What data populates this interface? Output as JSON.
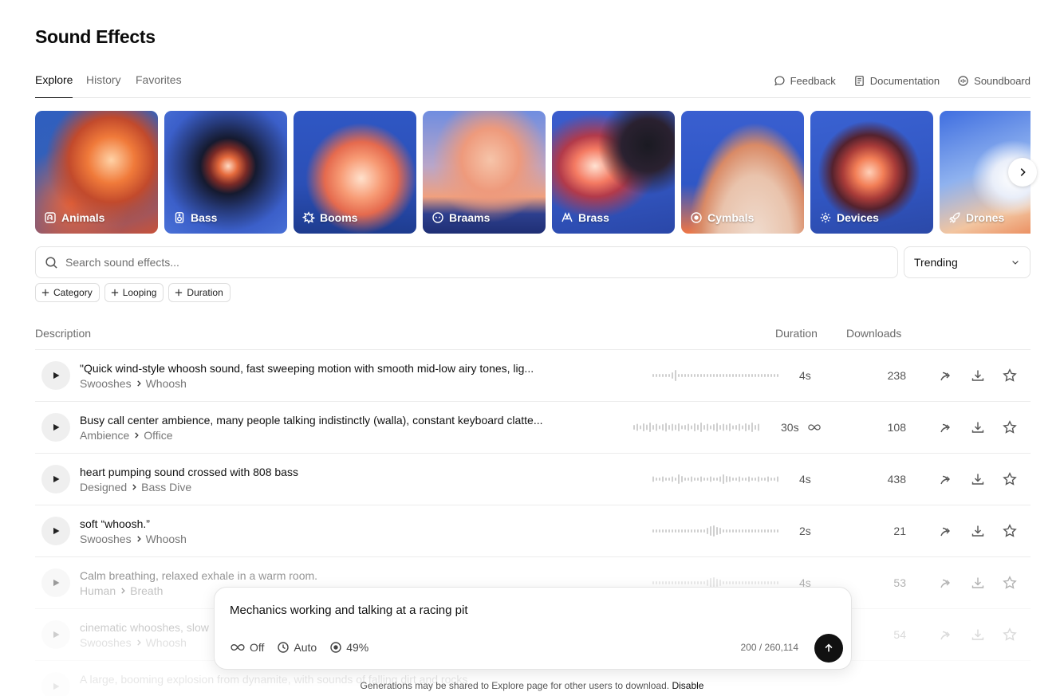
{
  "title": "Sound Effects",
  "tabs": [
    {
      "label": "Explore",
      "active": true
    },
    {
      "label": "History",
      "active": false
    },
    {
      "label": "Favorites",
      "active": false
    }
  ],
  "links": {
    "feedback": "Feedback",
    "documentation": "Documentation",
    "soundboard": "Soundboard"
  },
  "categories": [
    {
      "label": "Animals",
      "icon": "animals-icon"
    },
    {
      "label": "Bass",
      "icon": "speaker-icon"
    },
    {
      "label": "Booms",
      "icon": "explosion-icon"
    },
    {
      "label": "Braams",
      "icon": "alien-icon"
    },
    {
      "label": "Brass",
      "icon": "brass-icon"
    },
    {
      "label": "Cymbals",
      "icon": "cymbal-icon"
    },
    {
      "label": "Devices",
      "icon": "gear-icon"
    },
    {
      "label": "Drones",
      "icon": "rocket-icon"
    }
  ],
  "search": {
    "placeholder": "Search sound effects..."
  },
  "sort": {
    "value": "Trending"
  },
  "filters": [
    "Category",
    "Looping",
    "Duration"
  ],
  "columns": {
    "description": "Description",
    "duration": "Duration",
    "downloads": "Downloads"
  },
  "rows": [
    {
      "description": "\"Quick wind-style whoosh sound, fast sweeping motion with smooth mid-low airy tones, lig...",
      "category": "Swooshes",
      "subcategory": "Whoosh",
      "duration": "4s",
      "looping": false,
      "downloads": "238"
    },
    {
      "description": "Busy call center ambience, many people talking indistinctly (walla), constant keyboard clatte...",
      "category": "Ambience",
      "subcategory": "Office",
      "duration": "30s",
      "looping": true,
      "downloads": "108"
    },
    {
      "description": "heart pumping sound crossed with 808 bass",
      "category": "Designed",
      "subcategory": "Bass Dive",
      "duration": "4s",
      "looping": false,
      "downloads": "438"
    },
    {
      "description": "soft “whoosh.”",
      "category": "Swooshes",
      "subcategory": "Whoosh",
      "duration": "2s",
      "looping": false,
      "downloads": "21"
    },
    {
      "description": "Calm breathing, relaxed exhale in a warm room.",
      "category": "Human",
      "subcategory": "Breath",
      "duration": "4s",
      "looping": false,
      "downloads": "53"
    },
    {
      "description": "cinematic whooshes, slow",
      "category": "Swooshes",
      "subcategory": "Whoosh",
      "duration": "",
      "looping": false,
      "downloads": "54"
    },
    {
      "description": "A large, booming explosion from dynamite, with sounds of falling dirt and rocks",
      "category": "",
      "subcategory": "",
      "duration": "",
      "looping": false,
      "downloads": ""
    }
  ],
  "composer": {
    "prompt": "Mechanics working and talking at a racing pit",
    "loop": "Off",
    "duration": "Auto",
    "influence": "49%",
    "counter": "200 / 260,114"
  },
  "notice": {
    "text": "Generations may be shared to Explore page for other users to download.",
    "action": "Disable"
  },
  "colors": {
    "accent": "#111111",
    "muted": "#6b6b6b",
    "border": "#e6e6e6"
  }
}
